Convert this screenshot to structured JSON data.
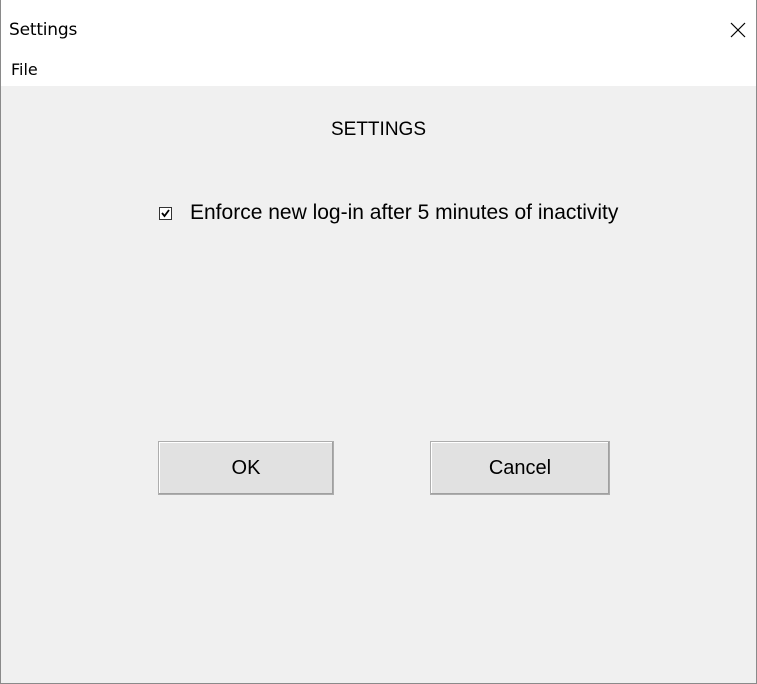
{
  "window": {
    "title": "Settings",
    "close_glyph": "close-icon"
  },
  "menu": {
    "items": [
      {
        "label": "File"
      }
    ]
  },
  "dialog": {
    "heading": "SETTINGS",
    "option": {
      "label": "Enforce new log-in after 5 minutes of inactivity",
      "checked": true
    },
    "ok_label": "OK",
    "cancel_label": "Cancel"
  },
  "colors": {
    "client_background": "#f0f0f0",
    "title_background": "#ffffff",
    "button_face": "#e1e1e1"
  }
}
